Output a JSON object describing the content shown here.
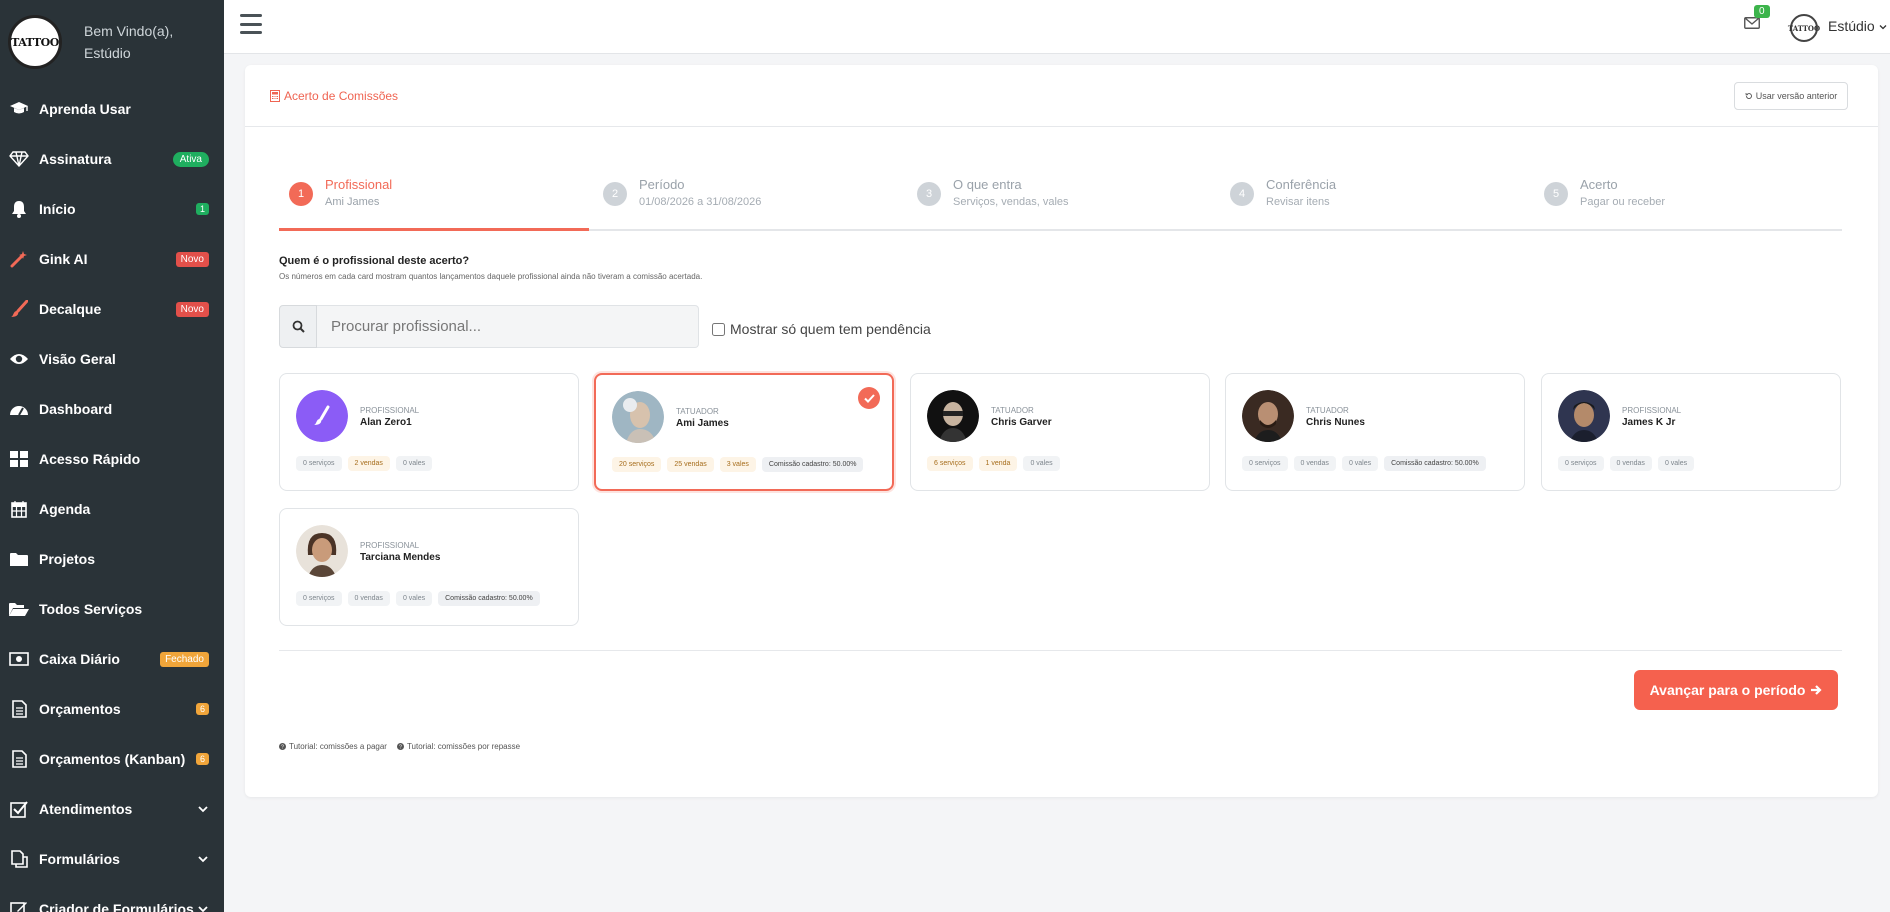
{
  "header": {
    "logo_text": "TATTOO",
    "welcome_line1": "Bem Vindo(a),",
    "welcome_line2": "Estúdio",
    "mail_count": "0",
    "user_name": "Estúdio"
  },
  "sidebar": {
    "items": [
      {
        "label": "Aprenda Usar",
        "icon": "graduation-cap-icon"
      },
      {
        "label": "Assinatura",
        "icon": "diamond-icon",
        "badge": "Ativa"
      },
      {
        "label": "Início",
        "icon": "bell-icon",
        "badge": "1"
      },
      {
        "label": "Gink AI",
        "icon": "magic-wand-icon",
        "badge": "Novo"
      },
      {
        "label": "Decalque",
        "icon": "paint-brush-icon",
        "badge": "Novo"
      },
      {
        "label": "Visão Geral",
        "icon": "eye-icon"
      },
      {
        "label": "Dashboard",
        "icon": "tachometer-icon"
      },
      {
        "label": "Acesso Rápido",
        "icon": "grid-icon"
      },
      {
        "label": "Agenda",
        "icon": "calendar-icon"
      },
      {
        "label": "Projetos",
        "icon": "folder-icon"
      },
      {
        "label": "Todos Serviços",
        "icon": "folder-open-icon"
      },
      {
        "label": "Caixa Diário",
        "icon": "money-icon",
        "badge": "Fechado"
      },
      {
        "label": "Orçamentos",
        "icon": "document-icon",
        "badge": "6"
      },
      {
        "label": "Orçamentos (Kanban)",
        "icon": "document-icon",
        "badge": "6"
      },
      {
        "label": "Atendimentos",
        "icon": "check-square-icon"
      },
      {
        "label": "Formulários",
        "icon": "copy-icon"
      },
      {
        "label": "Criador de Formulários",
        "icon": "edit-icon"
      }
    ],
    "colors": {
      "bg": "#2a3338",
      "badge_green": "#1fae5f",
      "badge_red": "#e2504a",
      "badge_orange": "#f0a53a"
    }
  },
  "page": {
    "title": "Acerto de Comissões",
    "old_version_label": "Usar versão anterior",
    "accent": "#f26a57"
  },
  "stepper": {
    "steps": [
      {
        "num": "1",
        "title": "Profissional",
        "sub": "Ami James",
        "active": true
      },
      {
        "num": "2",
        "title": "Período",
        "sub": "01/08/2026 a 31/08/2026"
      },
      {
        "num": "3",
        "title": "O que entra",
        "sub": "Serviços, vendas, vales"
      },
      {
        "num": "4",
        "title": "Conferência",
        "sub": "Revisar itens"
      },
      {
        "num": "5",
        "title": "Acerto",
        "sub": "Pagar ou receber"
      }
    ]
  },
  "selection": {
    "question": "Quem é o profissional deste acerto?",
    "hint": "Os números em cada card mostram quantos lançamentos daquele profissional ainda não tiveram a comissão acertada.",
    "search_placeholder": "Procurar profissional...",
    "search_value": "",
    "pending_only_label": "Mostrar só quem tem pendência"
  },
  "professionals": [
    {
      "role": "PROFISSIONAL",
      "name": "Alan Zero1",
      "services": "0 serviços",
      "sales": "2 vendas",
      "vouchers": "0 vales",
      "commission": ""
    },
    {
      "role": "TATUADOR",
      "name": "Ami James",
      "services": "20 serviços",
      "sales": "25 vendas",
      "vouchers": "3 vales",
      "commission": "Comissão cadastro: 50.00%",
      "selected": true
    },
    {
      "role": "TATUADOR",
      "name": "Chris Garver",
      "services": "6 serviços",
      "sales": "1 venda",
      "vouchers": "0 vales",
      "commission": ""
    },
    {
      "role": "TATUADOR",
      "name": "Chris Nunes",
      "services": "0 serviços",
      "sales": "0 vendas",
      "vouchers": "0 vales",
      "commission": "Comissão cadastro: 50.00%"
    },
    {
      "role": "PROFISSIONAL",
      "name": "James K Jr",
      "services": "0 serviços",
      "sales": "0 vendas",
      "vouchers": "0 vales",
      "commission": ""
    },
    {
      "role": "PROFISSIONAL",
      "name": "Tarciana Mendes",
      "services": "0 serviços",
      "sales": "0 vendas",
      "vouchers": "0 vales",
      "commission": "Comissão cadastro: 50.00%"
    }
  ],
  "actions": {
    "advance_label": "Avançar para o período"
  },
  "tutorials": [
    "Tutorial: comissões a pagar",
    "Tutorial: comissões por repasse"
  ]
}
